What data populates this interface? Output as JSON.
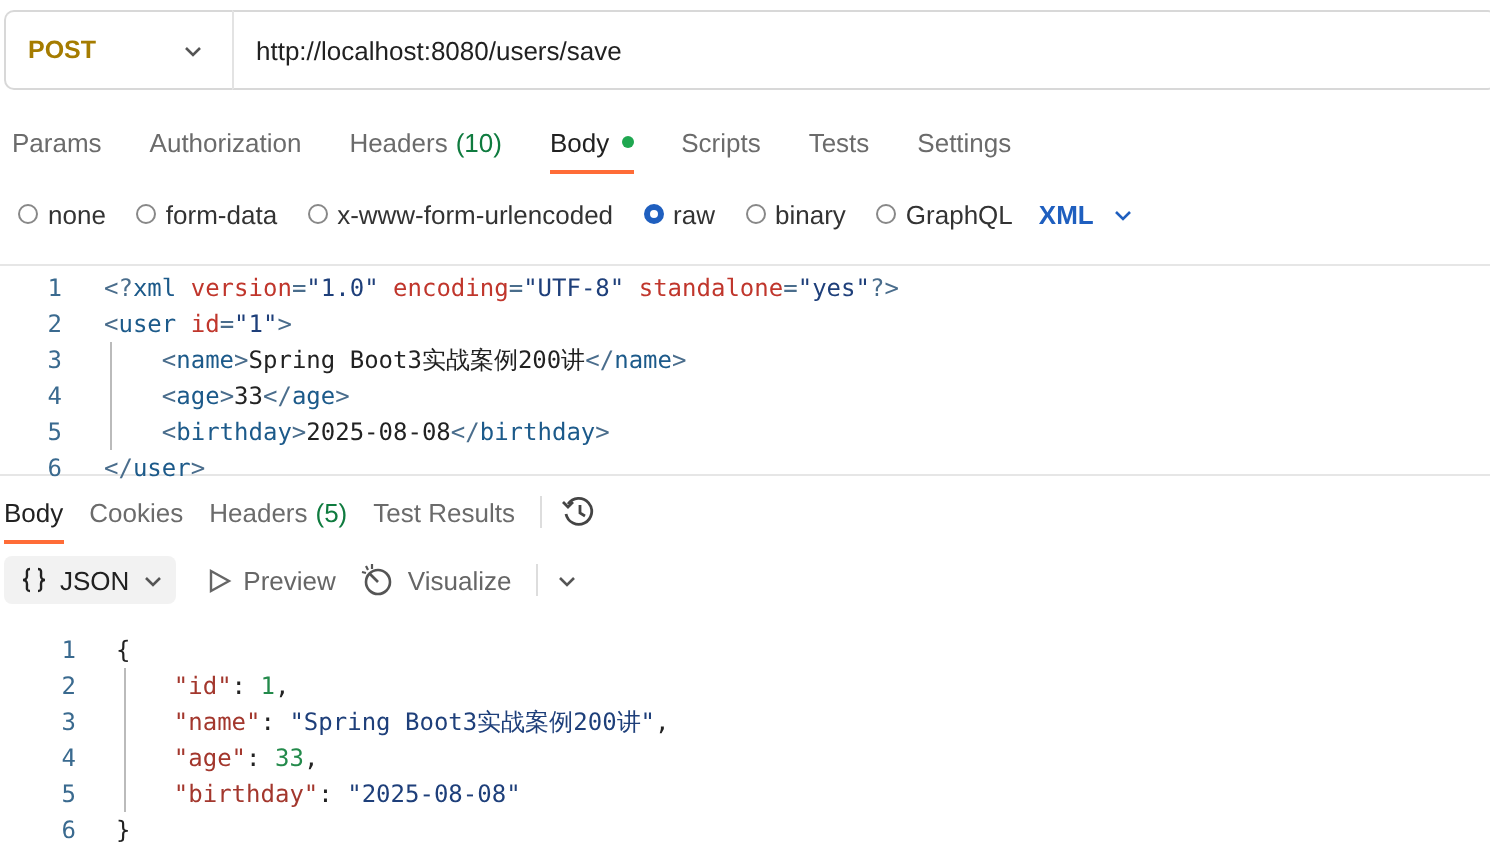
{
  "request": {
    "method": "POST",
    "url": "http://localhost:8080/users/save"
  },
  "request_tabs": [
    {
      "label": "Params",
      "selected": false
    },
    {
      "label": "Authorization",
      "selected": false
    },
    {
      "label": "Headers",
      "count": "(10)",
      "selected": false
    },
    {
      "label": "Body",
      "selected": true,
      "dot": true
    },
    {
      "label": "Scripts",
      "selected": false
    },
    {
      "label": "Tests",
      "selected": false
    },
    {
      "label": "Settings",
      "selected": false
    }
  ],
  "body_types": [
    {
      "label": "none",
      "selected": false
    },
    {
      "label": "form-data",
      "selected": false
    },
    {
      "label": "x-www-form-urlencoded",
      "selected": false
    },
    {
      "label": "raw",
      "selected": true
    },
    {
      "label": "binary",
      "selected": false
    },
    {
      "label": "GraphQL",
      "selected": false
    }
  ],
  "raw_format": "XML",
  "request_body": [
    {
      "number": "1",
      "tokens": [
        {
          "kind": "punct",
          "text": "<?"
        },
        {
          "kind": "tag",
          "text": "xml "
        },
        {
          "kind": "attr",
          "text": "version"
        },
        {
          "kind": "punct",
          "text": "="
        },
        {
          "kind": "str",
          "text": "\"1.0\" "
        },
        {
          "kind": "attr",
          "text": "encoding"
        },
        {
          "kind": "punct",
          "text": "="
        },
        {
          "kind": "str",
          "text": "\"UTF-8\" "
        },
        {
          "kind": "attr",
          "text": "standalone"
        },
        {
          "kind": "punct",
          "text": "="
        },
        {
          "kind": "str",
          "text": "\"yes\""
        },
        {
          "kind": "punct",
          "text": "?>"
        }
      ]
    },
    {
      "number": "2",
      "tokens": [
        {
          "kind": "punct",
          "text": "<"
        },
        {
          "kind": "tag",
          "text": "user "
        },
        {
          "kind": "attr",
          "text": "id"
        },
        {
          "kind": "punct",
          "text": "="
        },
        {
          "kind": "str",
          "text": "\"1\""
        },
        {
          "kind": "punct",
          "text": ">"
        }
      ]
    },
    {
      "number": "3",
      "tokens": [
        {
          "kind": "punct",
          "text": "    <"
        },
        {
          "kind": "tag",
          "text": "name"
        },
        {
          "kind": "punct",
          "text": ">"
        },
        {
          "kind": "text",
          "text": "Spring Boot3实战案例200讲"
        },
        {
          "kind": "punct",
          "text": "</"
        },
        {
          "kind": "tag",
          "text": "name"
        },
        {
          "kind": "punct",
          "text": ">"
        }
      ]
    },
    {
      "number": "4",
      "tokens": [
        {
          "kind": "punct",
          "text": "    <"
        },
        {
          "kind": "tag",
          "text": "age"
        },
        {
          "kind": "punct",
          "text": ">"
        },
        {
          "kind": "text",
          "text": "33"
        },
        {
          "kind": "punct",
          "text": "</"
        },
        {
          "kind": "tag",
          "text": "age"
        },
        {
          "kind": "punct",
          "text": ">"
        }
      ]
    },
    {
      "number": "5",
      "tokens": [
        {
          "kind": "punct",
          "text": "    <"
        },
        {
          "kind": "tag",
          "text": "birthday"
        },
        {
          "kind": "punct",
          "text": ">"
        },
        {
          "kind": "text",
          "text": "2025-08-08"
        },
        {
          "kind": "punct",
          "text": "</"
        },
        {
          "kind": "tag",
          "text": "birthday"
        },
        {
          "kind": "punct",
          "text": ">"
        }
      ]
    },
    {
      "number": "6",
      "tokens": [
        {
          "kind": "punct",
          "text": "</"
        },
        {
          "kind": "tag",
          "text": "user"
        },
        {
          "kind": "punct",
          "text": ">"
        }
      ]
    }
  ],
  "response_tabs": [
    {
      "label": "Body",
      "selected": true
    },
    {
      "label": "Cookies",
      "selected": false
    },
    {
      "label": "Headers",
      "count": "(5)",
      "selected": false
    },
    {
      "label": "Test Results",
      "selected": false
    }
  ],
  "response_toolbar": {
    "format": "JSON",
    "preview": "Preview",
    "visualize": "Visualize"
  },
  "response_body": [
    {
      "number": "1",
      "tokens": [
        {
          "kind": "punct",
          "text": "{"
        }
      ]
    },
    {
      "number": "2",
      "tokens": [
        {
          "kind": "key",
          "text": "    \"id\""
        },
        {
          "kind": "punct",
          "text": ": "
        },
        {
          "kind": "num",
          "text": "1"
        },
        {
          "kind": "punct",
          "text": ","
        }
      ]
    },
    {
      "number": "3",
      "tokens": [
        {
          "kind": "key",
          "text": "    \"name\""
        },
        {
          "kind": "punct",
          "text": ": "
        },
        {
          "kind": "str",
          "text": "\"Spring Boot3实战案例200讲\""
        },
        {
          "kind": "punct",
          "text": ","
        }
      ]
    },
    {
      "number": "4",
      "tokens": [
        {
          "kind": "key",
          "text": "    \"age\""
        },
        {
          "kind": "punct",
          "text": ": "
        },
        {
          "kind": "num",
          "text": "33"
        },
        {
          "kind": "punct",
          "text": ","
        }
      ]
    },
    {
      "number": "5",
      "tokens": [
        {
          "kind": "key",
          "text": "    \"birthday\""
        },
        {
          "kind": "punct",
          "text": ": "
        },
        {
          "kind": "str",
          "text": "\"2025-08-08\""
        }
      ]
    },
    {
      "number": "6",
      "tokens": [
        {
          "kind": "punct",
          "text": "}"
        }
      ]
    }
  ]
}
